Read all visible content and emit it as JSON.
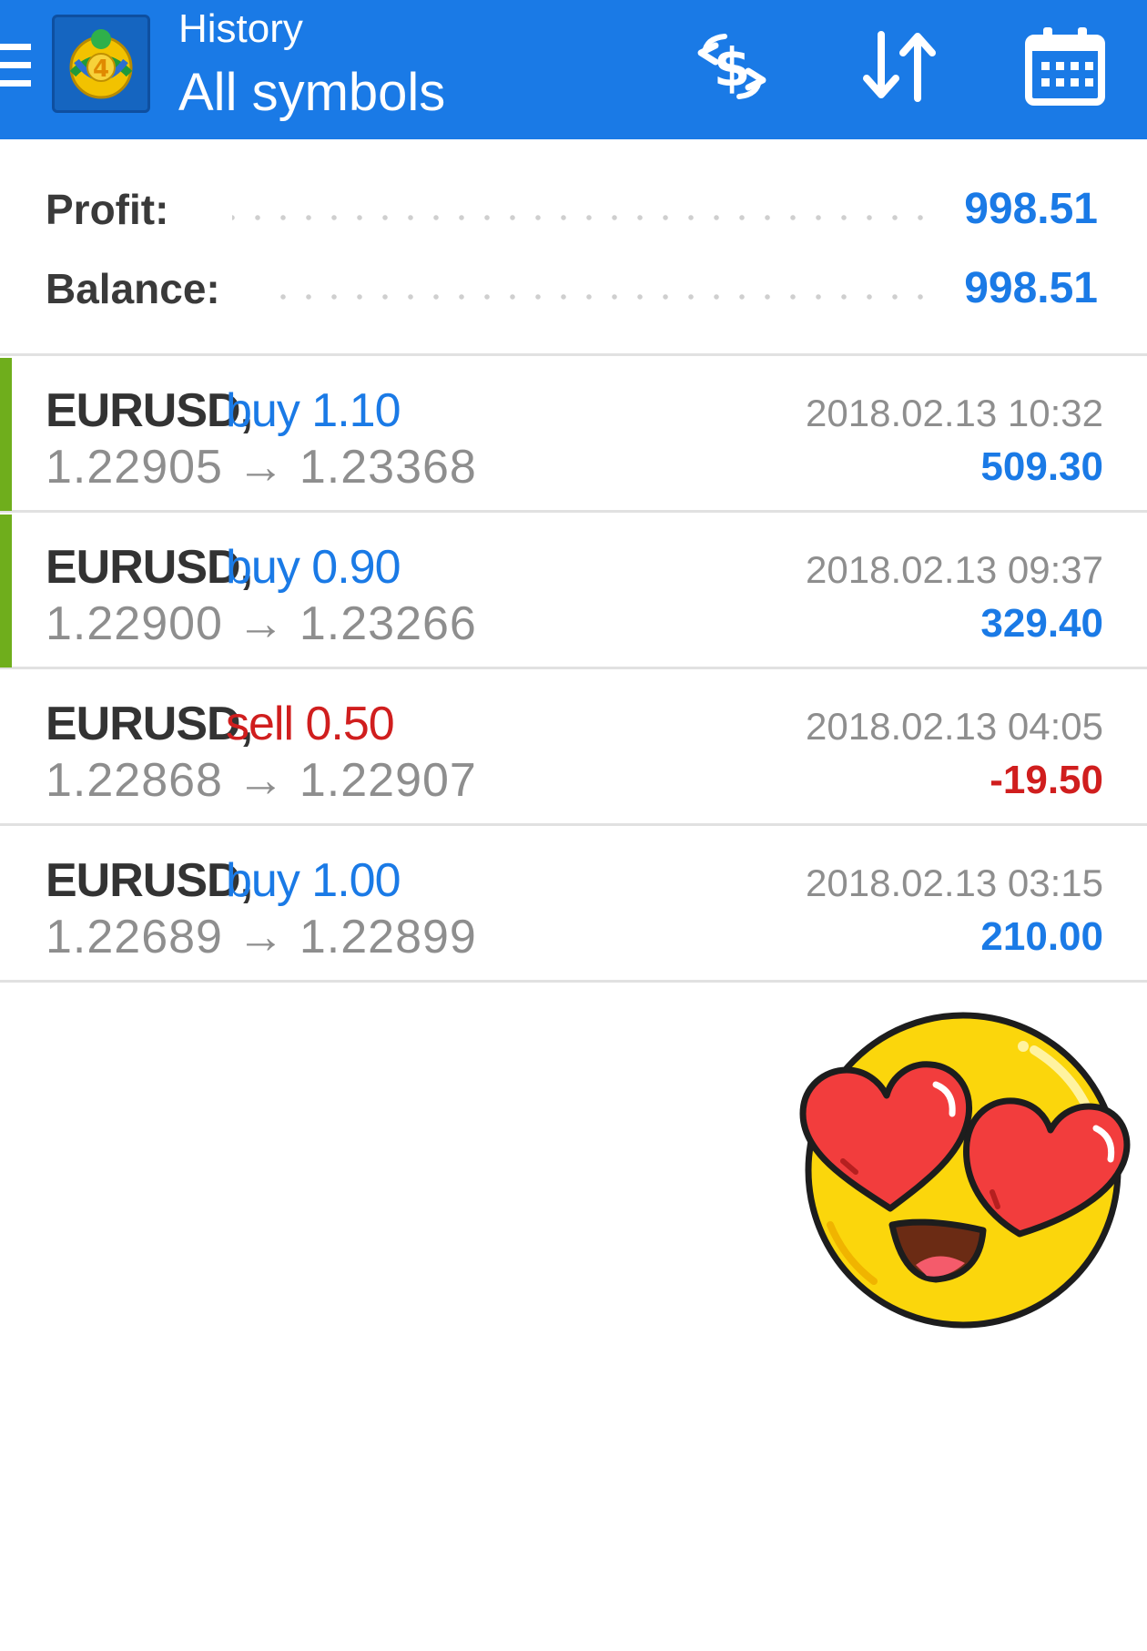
{
  "header": {
    "subtitle": "History",
    "title": "All symbols",
    "icons": [
      "menu-icon",
      "metatrader-4-logo",
      "currency-exchange-icon",
      "sort-icon",
      "calendar-icon"
    ],
    "logo_digit": "4"
  },
  "summary": {
    "profit_label": "Profit:",
    "profit_value": "998.51",
    "balance_label": "Balance:",
    "balance_value": "998.51"
  },
  "trades": [
    {
      "symbol": "EURUSD,",
      "side": "buy 1.10",
      "prices": "1.22905 → 1.23368",
      "time": "2018.02.13 10:32",
      "profit": "509.30",
      "type": "buy"
    },
    {
      "symbol": "EURUSD,",
      "side": "buy 0.90",
      "prices": "1.22900 → 1.23266",
      "time": "2018.02.13 09:37",
      "profit": "329.40",
      "type": "buy"
    },
    {
      "symbol": "EURUSD,",
      "side": "sell 0.50",
      "prices": "1.22868 → 1.22907",
      "time": "2018.02.13 04:05",
      "profit": "-19.50",
      "type": "sell"
    },
    {
      "symbol": "EURUSD,",
      "side": "buy 1.00",
      "prices": "1.22689 → 1.22899",
      "time": "2018.02.13 03:15",
      "profit": "210.00",
      "type": "buy"
    }
  ],
  "colors": {
    "header_bg": "#1a7ae6",
    "buy": "#1a7ae6",
    "sell": "#d01e1e",
    "profitable_accent": "#6fae1c"
  },
  "sticker": "heart-eyes-emoji"
}
